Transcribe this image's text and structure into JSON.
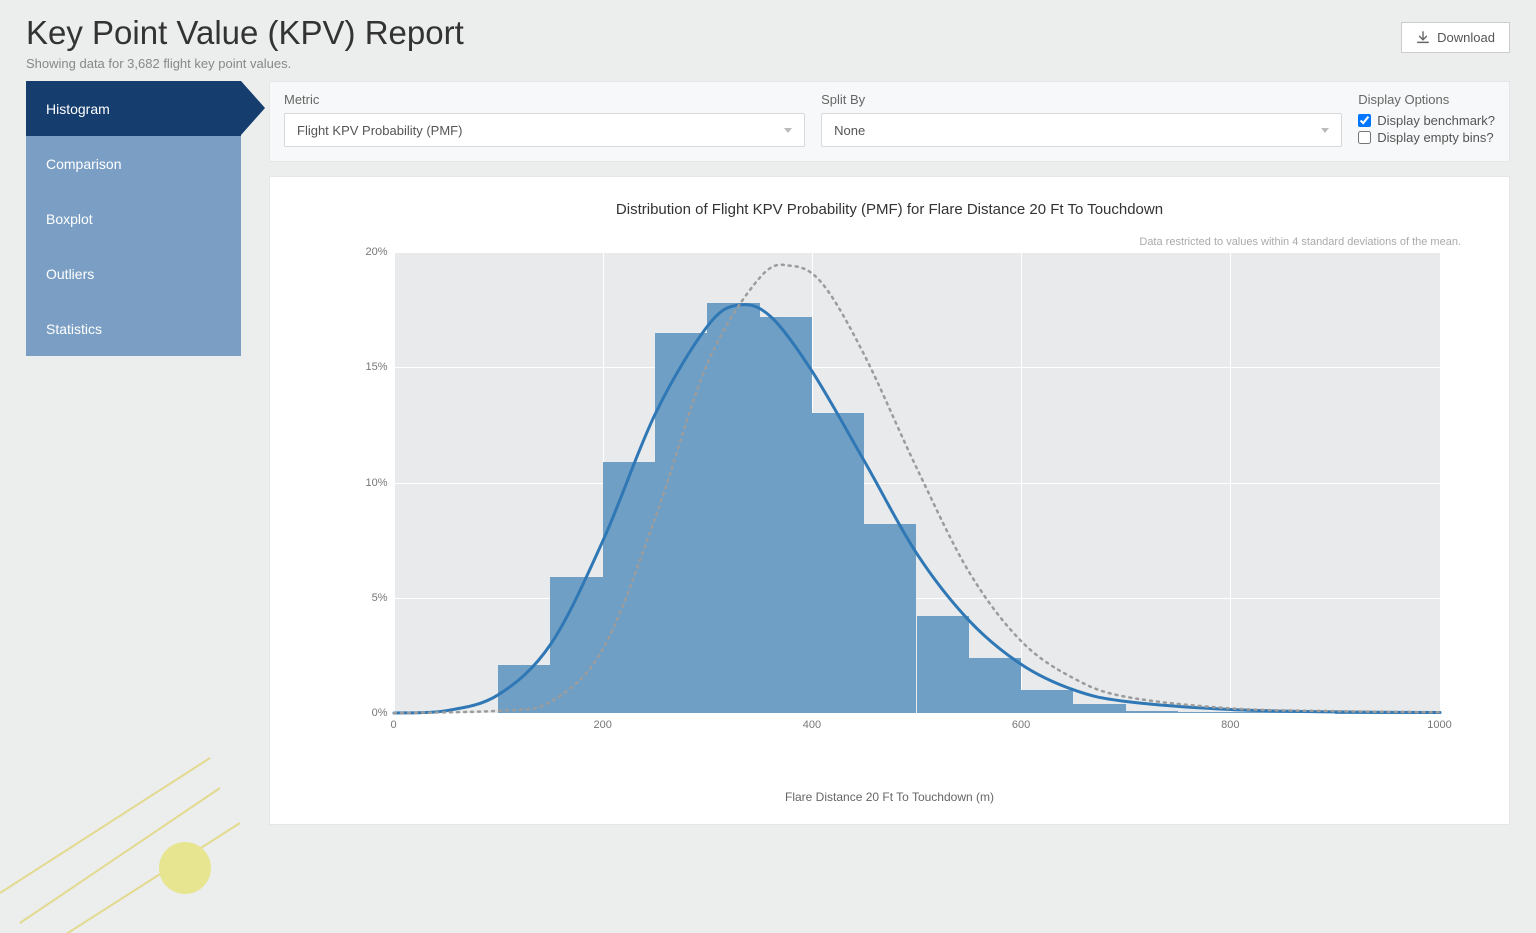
{
  "header": {
    "title": "Key Point Value (KPV) Report",
    "subtitle": "Showing data for 3,682 flight key point values.",
    "download_label": "Download"
  },
  "tabs": [
    {
      "label": "Histogram",
      "active": true
    },
    {
      "label": "Comparison",
      "active": false
    },
    {
      "label": "Boxplot",
      "active": false
    },
    {
      "label": "Outliers",
      "active": false
    },
    {
      "label": "Statistics",
      "active": false
    }
  ],
  "controls": {
    "metric_label": "Metric",
    "metric_value": "Flight KPV Probability (PMF)",
    "splitby_label": "Split By",
    "splitby_value": "None",
    "display_options_label": "Display Options",
    "display_benchmark_label": "Display benchmark?",
    "display_benchmark_checked": true,
    "display_empty_bins_label": "Display empty bins?",
    "display_empty_bins_checked": false
  },
  "chart_meta": {
    "title": "Distribution of Flight KPV Probability (PMF) for Flare Distance 20 Ft To Touchdown",
    "note": "Data restricted to values within 4 standard deviations of the mean."
  },
  "chart_data": {
    "type": "bar",
    "xlabel": "Flare Distance 20 Ft To Touchdown (m)",
    "ylabel": "Flight KPV Probability (PMF)",
    "ylim": [
      0,
      20
    ],
    "xlim": [
      0,
      1000
    ],
    "y_ticks": [
      0,
      5,
      10,
      15,
      20
    ],
    "y_tick_labels": [
      "0%",
      "5%",
      "10%",
      "15%",
      "20%"
    ],
    "x_ticks": [
      0,
      200,
      400,
      600,
      800,
      1000
    ],
    "bin_width": 50,
    "bars": [
      {
        "x0": 100,
        "value": 2.1
      },
      {
        "x0": 150,
        "value": 5.9
      },
      {
        "x0": 200,
        "value": 10.9
      },
      {
        "x0": 250,
        "value": 16.5
      },
      {
        "x0": 300,
        "value": 17.8
      },
      {
        "x0": 350,
        "value": 17.2
      },
      {
        "x0": 400,
        "value": 13.0
      },
      {
        "x0": 450,
        "value": 8.2
      },
      {
        "x0": 500,
        "value": 4.2
      },
      {
        "x0": 550,
        "value": 2.4
      },
      {
        "x0": 600,
        "value": 1.0
      },
      {
        "x0": 650,
        "value": 0.4
      },
      {
        "x0": 700,
        "value": 0.1
      },
      {
        "x0": 750,
        "value": 0.05
      },
      {
        "x0": 800,
        "value": 0.05
      },
      {
        "x0": 850,
        "value": 0.05
      },
      {
        "x0": 900,
        "value": 0.02
      },
      {
        "x0": 950,
        "value": 0.02
      }
    ],
    "series": [
      {
        "name": "fitted",
        "style": "solid",
        "color": "#2f78b5",
        "points": [
          {
            "x": 0,
            "y": 0.0
          },
          {
            "x": 50,
            "y": 0.1
          },
          {
            "x": 100,
            "y": 0.8
          },
          {
            "x": 150,
            "y": 3.0
          },
          {
            "x": 200,
            "y": 7.5
          },
          {
            "x": 250,
            "y": 13.0
          },
          {
            "x": 300,
            "y": 16.8
          },
          {
            "x": 330,
            "y": 17.7
          },
          {
            "x": 360,
            "y": 17.2
          },
          {
            "x": 400,
            "y": 14.8
          },
          {
            "x": 450,
            "y": 10.9
          },
          {
            "x": 500,
            "y": 6.9
          },
          {
            "x": 550,
            "y": 4.0
          },
          {
            "x": 600,
            "y": 2.1
          },
          {
            "x": 650,
            "y": 1.0
          },
          {
            "x": 700,
            "y": 0.5
          },
          {
            "x": 800,
            "y": 0.15
          },
          {
            "x": 900,
            "y": 0.05
          },
          {
            "x": 1000,
            "y": 0.02
          }
        ]
      },
      {
        "name": "benchmark",
        "style": "dotted",
        "color": "#9c9c9c",
        "points": [
          {
            "x": 0,
            "y": 0.0
          },
          {
            "x": 100,
            "y": 0.1
          },
          {
            "x": 150,
            "y": 0.5
          },
          {
            "x": 200,
            "y": 2.8
          },
          {
            "x": 250,
            "y": 8.5
          },
          {
            "x": 300,
            "y": 15.2
          },
          {
            "x": 350,
            "y": 18.9
          },
          {
            "x": 380,
            "y": 19.4
          },
          {
            "x": 410,
            "y": 18.6
          },
          {
            "x": 450,
            "y": 15.5
          },
          {
            "x": 500,
            "y": 10.6
          },
          {
            "x": 550,
            "y": 6.1
          },
          {
            "x": 600,
            "y": 3.1
          },
          {
            "x": 650,
            "y": 1.5
          },
          {
            "x": 700,
            "y": 0.7
          },
          {
            "x": 800,
            "y": 0.2
          },
          {
            "x": 900,
            "y": 0.08
          },
          {
            "x": 1000,
            "y": 0.03
          }
        ]
      }
    ]
  }
}
